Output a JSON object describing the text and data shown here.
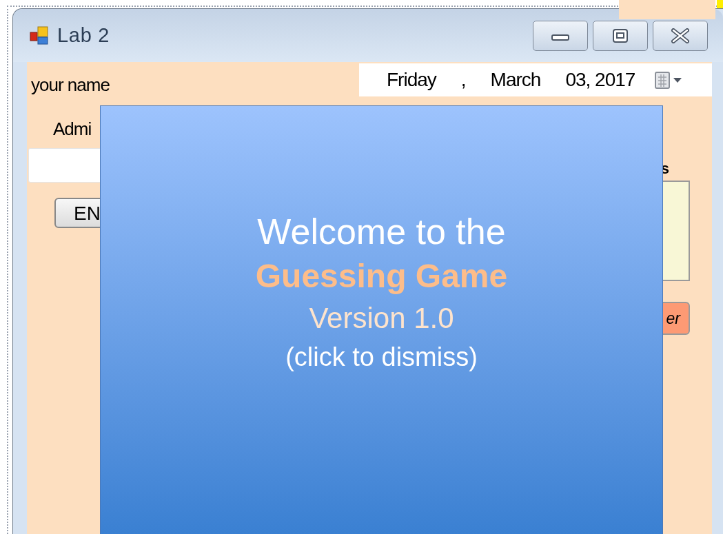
{
  "window": {
    "title": "Lab 2",
    "controls": [
      {
        "kind": "minimize"
      },
      {
        "kind": "maximize"
      },
      {
        "kind": "close"
      }
    ]
  },
  "form": {
    "name_label": "your name",
    "date_picker": {
      "day": "Friday",
      "separator": ",",
      "month": "March",
      "date": "03, 2017"
    },
    "admin_label": "Admi",
    "enter_button": "EN",
    "right_label": "s",
    "right_button": "er"
  },
  "splash": {
    "line_1": "Welcome to the",
    "title": "Guessing Game",
    "version": "Version 1.0",
    "hint": "(click to dismiss)"
  }
}
